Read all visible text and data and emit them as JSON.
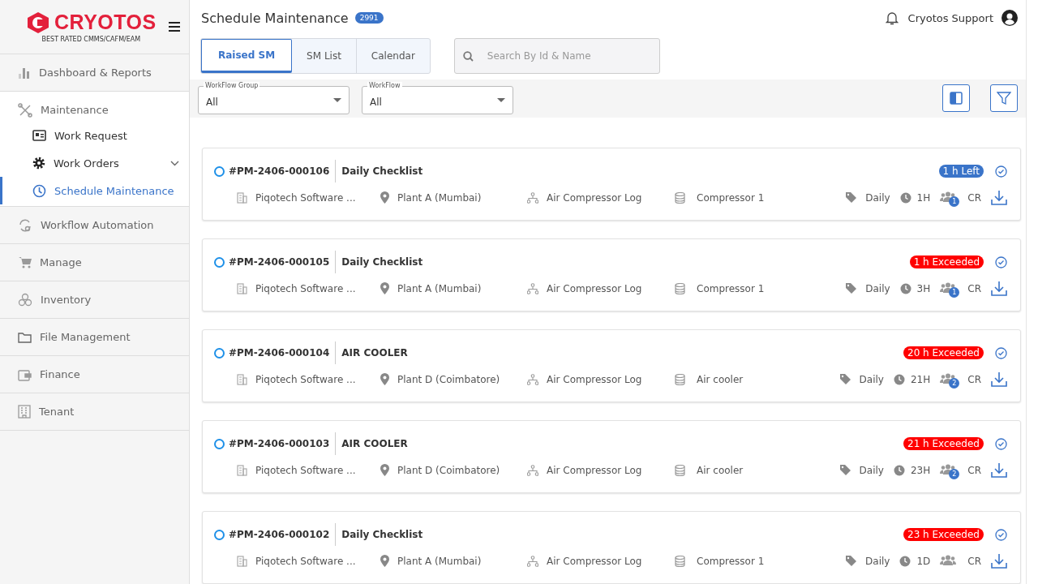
{
  "logo": {
    "name": "CRYOTOS",
    "tagline": "BEST RATED CMMS/CAFM/EAM"
  },
  "sidebar": {
    "items": [
      {
        "label": "Dashboard & Reports",
        "expanded": false
      },
      {
        "label": "Maintenance",
        "expanded": true,
        "children": [
          {
            "label": "Work Request",
            "selected": false,
            "has_submenu": false
          },
          {
            "label": "Work Orders",
            "selected": false,
            "has_submenu": true
          },
          {
            "label": "Schedule Maintenance",
            "selected": true,
            "has_submenu": false
          }
        ]
      },
      {
        "label": "Workflow Automation",
        "expanded": false
      },
      {
        "label": "Manage",
        "expanded": false
      },
      {
        "label": "Inventory",
        "expanded": false
      },
      {
        "label": "File Management",
        "expanded": false
      },
      {
        "label": "Finance",
        "expanded": false
      },
      {
        "label": "Tenant",
        "expanded": false
      }
    ]
  },
  "header": {
    "title": "Schedule Maintenance",
    "count": "2991",
    "user": "Cryotos Support"
  },
  "tabs": [
    {
      "label": "Raised SM",
      "selected": true
    },
    {
      "label": "SM List",
      "selected": false
    },
    {
      "label": "Calendar",
      "selected": false
    }
  ],
  "search": {
    "placeholder": "Search By Id & Name"
  },
  "filters": [
    {
      "label": "WorkFlow Group",
      "value": "All"
    },
    {
      "label": "WorkFlow",
      "value": "All"
    }
  ],
  "cards": [
    {
      "selected": false,
      "id": "#PM-2406-000106",
      "title": "Daily Checklist",
      "status": {
        "kind": "left",
        "text": "1 h Left"
      },
      "company": "Piqotech Software ...",
      "location": "Plant A (Mumbai)",
      "workflow": "Air Compressor Log",
      "asset": "Compressor 1",
      "frequency": "Daily",
      "duration": "1H",
      "assignees": "1",
      "initials": "CR"
    },
    {
      "selected": false,
      "id": "#PM-2406-000105",
      "title": "Daily Checklist",
      "status": {
        "kind": "exceeded",
        "text": "1 h Exceeded"
      },
      "company": "Piqotech Software ...",
      "location": "Plant A (Mumbai)",
      "workflow": "Air Compressor Log",
      "asset": "Compressor 1",
      "frequency": "Daily",
      "duration": "3H",
      "assignees": "1",
      "initials": "CR"
    },
    {
      "selected": false,
      "id": "#PM-2406-000104",
      "title": "AIR COOLER",
      "status": {
        "kind": "exceeded",
        "text": "20 h Exceeded"
      },
      "company": "Piqotech Software ...",
      "location": "Plant D (Coimbatore)",
      "workflow": "Air Compressor Log",
      "asset": "Air cooler",
      "frequency": "Daily",
      "duration": "21H",
      "assignees": "2",
      "initials": "CR"
    },
    {
      "selected": false,
      "id": "#PM-2406-000103",
      "title": "AIR COOLER",
      "status": {
        "kind": "exceeded",
        "text": "21 h Exceeded"
      },
      "company": "Piqotech Software ...",
      "location": "Plant D (Coimbatore)",
      "workflow": "Air Compressor Log",
      "asset": "Air cooler",
      "frequency": "Daily",
      "duration": "23H",
      "assignees": "2",
      "initials": "CR"
    },
    {
      "selected": false,
      "id": "#PM-2406-000102",
      "title": "Daily Checklist",
      "status": {
        "kind": "exceeded",
        "text": "23 h Exceeded"
      },
      "company": "Piqotech Software ...",
      "location": "Plant A (Mumbai)",
      "workflow": "Air Compressor Log",
      "asset": "Compressor 1",
      "frequency": "Daily",
      "duration": "1D",
      "initials": "CR"
    }
  ]
}
